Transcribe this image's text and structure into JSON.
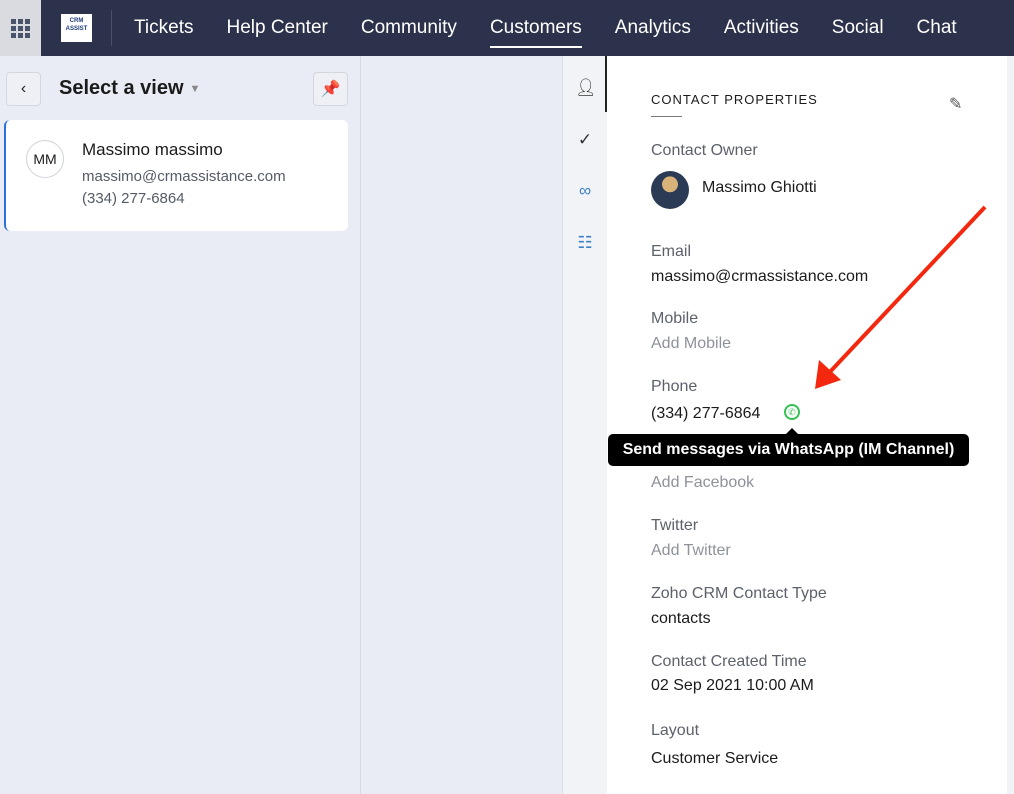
{
  "nav": {
    "logo_text": "CRM ASSISTANCE",
    "tabs": [
      "Tickets",
      "Help Center",
      "Community",
      "Customers",
      "Analytics",
      "Activities",
      "Social",
      "Chat"
    ],
    "active": "Customers"
  },
  "list": {
    "view_label": "Select a view",
    "contact": {
      "initials": "MM",
      "name": "Massimo massimo",
      "email": "massimo@crmassistance.com",
      "phone": "(334) 277-6864"
    }
  },
  "panel": {
    "title": "CONTACT PROPERTIES",
    "owner_label": "Contact Owner",
    "owner": "Massimo Ghiotti",
    "email_label": "Email",
    "email": "massimo@crmassistance.com",
    "mobile_label": "Mobile",
    "mobile_placeholder": "Add Mobile",
    "phone_label": "Phone",
    "phone": "(334) 277-6864",
    "facebook_placeholder": "Add Facebook",
    "twitter_label": "Twitter",
    "twitter_placeholder": "Add Twitter",
    "crm_type_label": "Zoho CRM Contact Type",
    "crm_type": "contacts",
    "created_label": "Contact Created Time",
    "created": "02 Sep 2021 10:00 AM",
    "layout_label": "Layout",
    "layout": "Customer Service"
  },
  "tooltip": "Send messages via WhatsApp (IM Channel)",
  "colors": {
    "nav_bg": "#2c324b",
    "accent": "#2a6fdb",
    "whatsapp": "#35c152",
    "annotation_arrow": "#f4280f"
  }
}
